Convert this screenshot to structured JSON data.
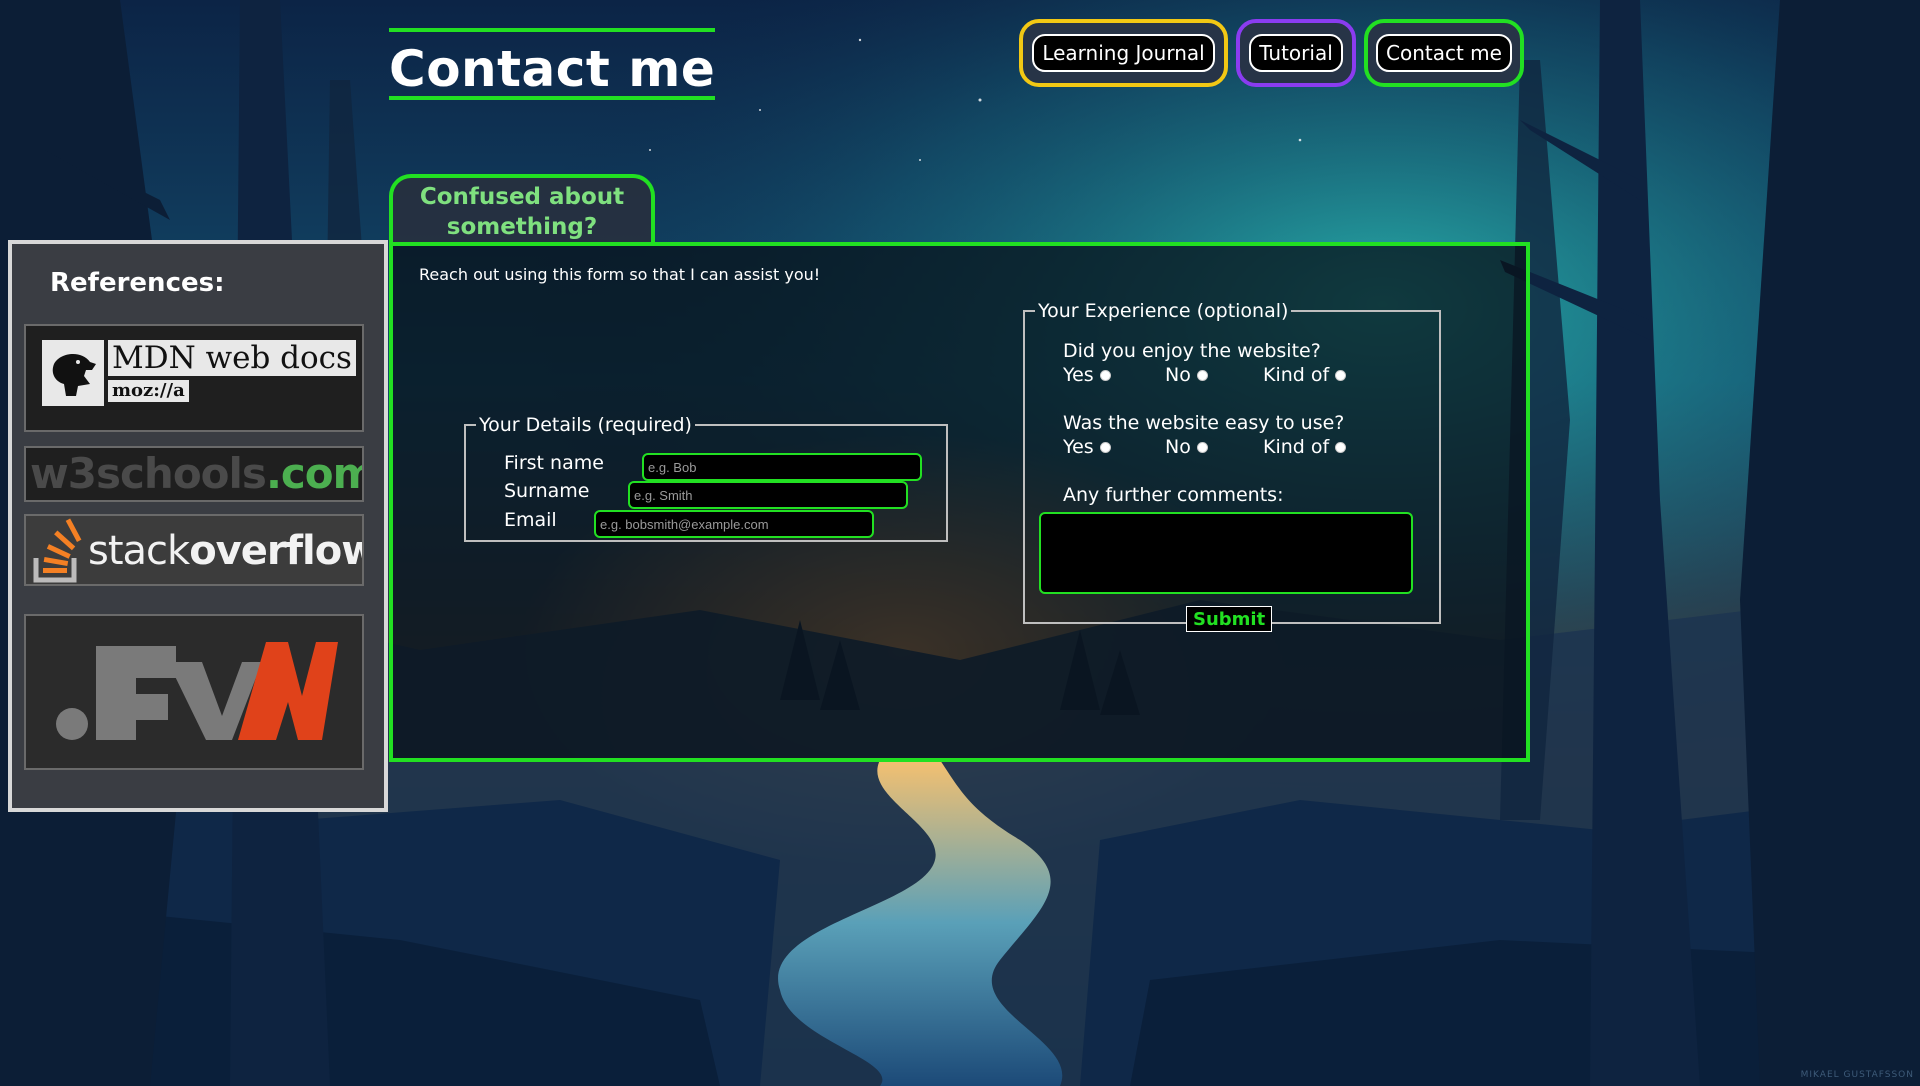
{
  "header": {
    "title": "Contact me"
  },
  "nav": {
    "items": [
      {
        "label": "Learning Journal"
      },
      {
        "label": "Tutorial"
      },
      {
        "label": "Contact me"
      }
    ]
  },
  "references": {
    "heading": "References:",
    "mdn": {
      "title": "MDN web docs",
      "sub": "moz://a"
    },
    "w3schools": {
      "main": "w3schools",
      "tld": ".com"
    },
    "stackoverflow": {
      "light": "stack",
      "bold": "overflow"
    }
  },
  "tab": {
    "label": "Confused about something?"
  },
  "form": {
    "intro": "Reach out using this form so that I can assist you!",
    "details": {
      "legend": "Your Details (required)",
      "first_name_label": "First name",
      "first_name_placeholder": "e.g. Bob",
      "surname_label": "Surname",
      "surname_placeholder": "e.g. Smith",
      "email_label": "Email",
      "email_placeholder": "e.g. bobsmith@example.com"
    },
    "experience": {
      "legend": "Your Experience (optional)",
      "q1": "Did you enjoy the website?",
      "q2": "Was the website easy to use?",
      "options": [
        "Yes",
        "No",
        "Kind of"
      ],
      "comments_label": "Any further comments:",
      "submit_label": "Submit"
    }
  },
  "credit": "MIKAEL GUSTAFSSON",
  "colors": {
    "accent_green": "#22e022",
    "journal_yellow": "#f2c814",
    "tutorial_purple": "#8a3cf0"
  }
}
